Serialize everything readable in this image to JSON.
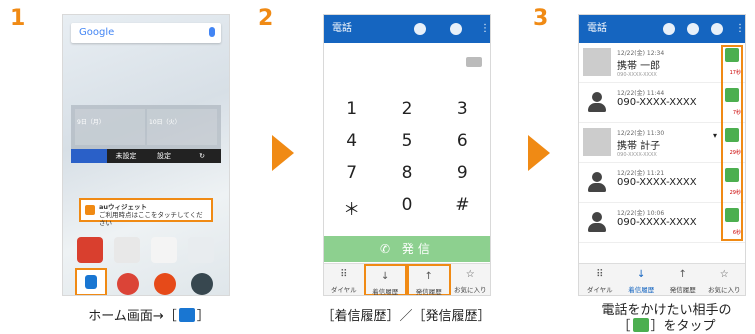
{
  "steps": [
    {
      "number": "1",
      "caption_pre": "ホーム画面→［",
      "caption_post": "］"
    },
    {
      "number": "2",
      "caption": "［着信履歴］／［発信履歴］"
    },
    {
      "number": "3",
      "caption_line1": "電話をかけたい相手の",
      "caption_line2_pre": "［",
      "caption_line2_post": "］をタップ"
    }
  ],
  "home": {
    "search_label": "Google",
    "widget_weekdays": [
      "9日（月）",
      "10日（火）"
    ],
    "widget_bar": [
      "未設定",
      "設定"
    ],
    "au_widget_line1": "auウィジェット",
    "au_widget_line2": "ご利用時点はここをタッチしてください"
  },
  "dialer": {
    "title": "電話",
    "keys": [
      "1",
      "2",
      "3",
      "4",
      "5",
      "6",
      "7",
      "8",
      "9",
      "＊",
      "0",
      "#"
    ],
    "call_label": "発信",
    "tabs": [
      "ダイヤル",
      "着信履歴",
      "発信履歴",
      "お気に入り"
    ]
  },
  "history": {
    "title": "電話",
    "entries": [
      {
        "time": "12/22(金) 12:34",
        "name": "携帯 一郎",
        "sub": "090-XXXX-XXXX",
        "duration": "17秒"
      },
      {
        "time": "12/22(金) 11:44",
        "name": "090-XXXX-XXXX",
        "sub": "",
        "duration": "7秒"
      },
      {
        "time": "12/22(金) 11:30",
        "name": "携帯 計子",
        "sub": "090-XXXX-XXXX",
        "duration": "29秒"
      },
      {
        "time": "12/22(金) 11:21",
        "name": "090-XXXX-XXXX",
        "sub": "",
        "duration": "29秒"
      },
      {
        "time": "12/22(金) 10:06",
        "name": "090-XXXX-XXXX",
        "sub": "",
        "duration": "6秒"
      }
    ],
    "tabs": [
      "ダイヤル",
      "着信履歴",
      "発信履歴",
      "お気に入り"
    ]
  }
}
